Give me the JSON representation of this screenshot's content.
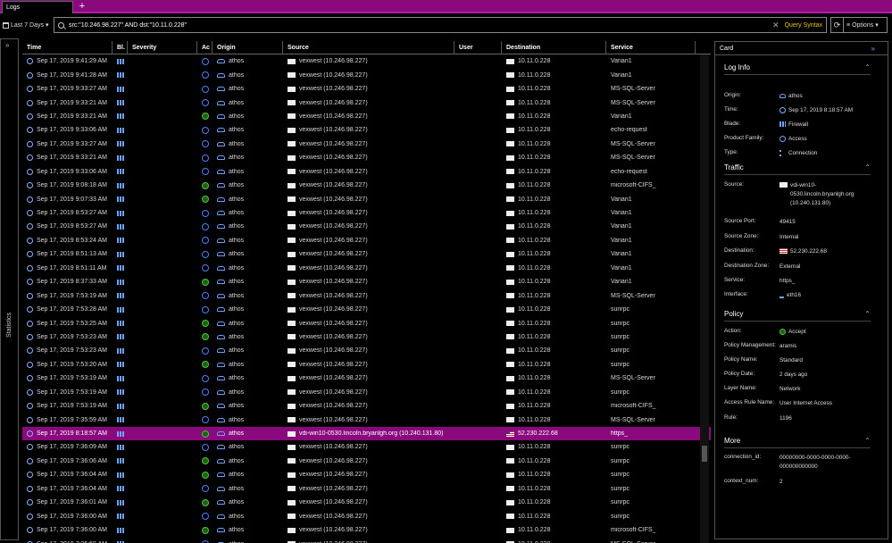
{
  "tabs": {
    "active": "Logs",
    "add": "+"
  },
  "filter": {
    "time_range": "Last 7 Days",
    "query": "src:\"10.246.98.227\" AND dst:\"10.11.0.228\"",
    "clear": "✕",
    "query_syntax": "Query Syntax",
    "refresh": "⟳",
    "options": "Options"
  },
  "statistics": {
    "collapse": "»",
    "label": "Statistics"
  },
  "columns": [
    "Time",
    "Bl.",
    "Severity",
    "Ac",
    "Origin",
    "Source",
    "User",
    "Destination",
    "Service"
  ],
  "rows": [
    {
      "time": "Sep 17, 2019 9:41:29 AM",
      "action": "block",
      "origin": "athos",
      "source": "vexwest (10.246.98.227)",
      "dest": "10.11.0.228",
      "service": "Varian1"
    },
    {
      "time": "Sep 17, 2019 9:41:28 AM",
      "action": "block",
      "origin": "athos",
      "source": "vexwest (10.246.98.227)",
      "dest": "10.11.0.228",
      "service": "Varian1"
    },
    {
      "time": "Sep 17, 2019 9:33:27 AM",
      "action": "block",
      "origin": "athos",
      "source": "vexwest (10.246.98.227)",
      "dest": "10.11.0.228",
      "service": "MS-SQL-Server"
    },
    {
      "time": "Sep 17, 2019 9:33:21 AM",
      "action": "block",
      "origin": "athos",
      "source": "vexwest (10.246.98.227)",
      "dest": "10.11.0.228",
      "service": "MS-SQL-Server"
    },
    {
      "time": "Sep 17, 2019 9:33:21 AM",
      "action": "accept",
      "origin": "athos",
      "source": "vexwest (10.246.98.227)",
      "dest": "10.11.0.228",
      "service": "Varian1"
    },
    {
      "time": "Sep 17, 2019 9:33:06 AM",
      "action": "block",
      "origin": "athos",
      "source": "vexwest (10.246.98.227)",
      "dest": "10.11.0.228",
      "service": "echo-request"
    },
    {
      "time": "Sep 17, 2019 9:33:27 AM",
      "action": "block",
      "origin": "athos",
      "source": "vexwest (10.246.98.227)",
      "dest": "10.11.0.228",
      "service": "MS-SQL-Server"
    },
    {
      "time": "Sep 17, 2019 9:33:21 AM",
      "action": "block",
      "origin": "athos",
      "source": "vexwest (10.246.98.227)",
      "dest": "10.11.0.228",
      "service": "MS-SQL-Server"
    },
    {
      "time": "Sep 17, 2019 9:33:06 AM",
      "action": "block",
      "origin": "athos",
      "source": "vexwest (10.246.98.227)",
      "dest": "10.11.0.228",
      "service": "echo-request"
    },
    {
      "time": "Sep 17, 2019 9:08:18 AM",
      "action": "accept",
      "origin": "athos",
      "source": "vexwest (10.246.98.227)",
      "dest": "10.11.0.228",
      "service": "microsoft-CIFS_"
    },
    {
      "time": "Sep 17, 2019 9:07:33 AM",
      "action": "accept",
      "origin": "athos",
      "source": "vexwest (10.246.98.227)",
      "dest": "10.11.0.228",
      "service": "Varian1"
    },
    {
      "time": "Sep 17, 2019 8:53:27 AM",
      "action": "block",
      "origin": "athos",
      "source": "vexwest (10.246.98.227)",
      "dest": "10.11.0.228",
      "service": "Varian1"
    },
    {
      "time": "Sep 17, 2019 8:53:27 AM",
      "action": "block",
      "origin": "athos",
      "source": "vexwest (10.246.98.227)",
      "dest": "10.11.0.228",
      "service": "Varian1"
    },
    {
      "time": "Sep 17, 2019 8:53:24 AM",
      "action": "block",
      "origin": "athos",
      "source": "vexwest (10.246.98.227)",
      "dest": "10.11.0.228",
      "service": "Varian1"
    },
    {
      "time": "Sep 17, 2019 8:51:13 AM",
      "action": "block",
      "origin": "athos",
      "source": "vexwest (10.246.98.227)",
      "dest": "10.11.0.228",
      "service": "Varian1"
    },
    {
      "time": "Sep 17, 2019 8:51:11 AM",
      "action": "block",
      "origin": "athos",
      "source": "vexwest (10.246.98.227)",
      "dest": "10.11.0.228",
      "service": "Varian1"
    },
    {
      "time": "Sep 17, 2019 8:37:33 AM",
      "action": "accept",
      "origin": "athos",
      "source": "vexwest (10.246.98.227)",
      "dest": "10.11.0.228",
      "service": "Varian1"
    },
    {
      "time": "Sep 17, 2019 7:53:19 AM",
      "action": "block",
      "origin": "athos",
      "source": "vexwest (10.246.98.227)",
      "dest": "10.11.0.228",
      "service": "MS-SQL-Server"
    },
    {
      "time": "Sep 17, 2019 7:53:28 AM",
      "action": "block",
      "origin": "athos",
      "source": "vexwest (10.246.98.227)",
      "dest": "10.11.0.228",
      "service": "sunrpc"
    },
    {
      "time": "Sep 17, 2019 7:53:25 AM",
      "action": "accept",
      "origin": "athos",
      "source": "vexwest (10.246.98.227)",
      "dest": "10.11.0.228",
      "service": "sunrpc"
    },
    {
      "time": "Sep 17, 2019 7:53:23 AM",
      "action": "accept",
      "origin": "athos",
      "source": "vexwest (10.246.98.227)",
      "dest": "10.11.0.228",
      "service": "sunrpc"
    },
    {
      "time": "Sep 17, 2019 7:53:23 AM",
      "action": "block",
      "origin": "athos",
      "source": "vexwest (10.246.98.227)",
      "dest": "10.11.0.228",
      "service": "sunrpc"
    },
    {
      "time": "Sep 17, 2019 7:53:20 AM",
      "action": "accept",
      "origin": "athos",
      "source": "vexwest (10.246.98.227)",
      "dest": "10.11.0.228",
      "service": "sunrpc"
    },
    {
      "time": "Sep 17, 2019 7:53:19 AM",
      "action": "block",
      "origin": "athos",
      "source": "vexwest (10.246.98.227)",
      "dest": "10.11.0.228",
      "service": "MS-SQL-Server"
    },
    {
      "time": "Sep 17, 2019 7:53:19 AM",
      "action": "block",
      "origin": "athos",
      "source": "vexwest (10.246.98.227)",
      "dest": "10.11.0.228",
      "service": "sunrpc"
    },
    {
      "time": "Sep 17, 2019 7:53:19 AM",
      "action": "accept",
      "origin": "athos",
      "source": "vexwest (10.246.98.227)",
      "dest": "10.11.0.228",
      "service": "microsoft-CIFS_"
    },
    {
      "time": "Sep 17, 2019 7:35:59 AM",
      "action": "block",
      "origin": "athos",
      "source": "vexwest (10.246.98.227)",
      "dest": "10.11.0.228",
      "service": "MS-SQL-Server"
    },
    {
      "time": "Sep 17, 2019 8:18:57 AM",
      "action": "accept",
      "origin": "athos",
      "source": "vdi-win10-0530.lincoln.bryanlgh.org (10.240.131.80)",
      "dest": "52.230.222.68",
      "service": "https_",
      "selected": true
    },
    {
      "time": "Sep 17, 2019 7:36:09 AM",
      "action": "block",
      "origin": "athos",
      "source": "vexwest (10.246.98.227)",
      "dest": "10.11.0.228",
      "service": "sunrpc"
    },
    {
      "time": "Sep 17, 2019 7:36:06 AM",
      "action": "accept",
      "origin": "athos",
      "source": "vexwest (10.246.98.227)",
      "dest": "10.11.0.228",
      "service": "sunrpc"
    },
    {
      "time": "Sep 17, 2019 7:36:04 AM",
      "action": "accept",
      "origin": "athos",
      "source": "vexwest (10.246.98.227)",
      "dest": "10.11.0.228",
      "service": "sunrpc"
    },
    {
      "time": "Sep 17, 2019 7:36:04 AM",
      "action": "block",
      "origin": "athos",
      "source": "vexwest (10.246.98.227)",
      "dest": "10.11.0.228",
      "service": "sunrpc"
    },
    {
      "time": "Sep 17, 2019 7:36:01 AM",
      "action": "accept",
      "origin": "athos",
      "source": "vexwest (10.246.98.227)",
      "dest": "10.11.0.228",
      "service": "sunrpc"
    },
    {
      "time": "Sep 17, 2019 7:36:00 AM",
      "action": "block",
      "origin": "athos",
      "source": "vexwest (10.246.98.227)",
      "dest": "10.11.0.228",
      "service": "sunrpc"
    },
    {
      "time": "Sep 17, 2019 7:36:00 AM",
      "action": "accept",
      "origin": "athos",
      "source": "vexwest (10.246.98.227)",
      "dest": "10.11.0.228",
      "service": "microsoft-CIFS_"
    },
    {
      "time": "Sep 17, 2019 7:35:59 AM",
      "action": "block",
      "origin": "athos",
      "source": "vexwest (10.246.98.227)",
      "dest": "10.11.0.228",
      "service": "MS-SQL-Server"
    }
  ],
  "card": {
    "title": "Card",
    "collapse": "»",
    "sections": {
      "log_info": "Log Info",
      "traffic": "Traffic",
      "policy": "Policy",
      "more": "More"
    },
    "log_info": [
      {
        "k": "Origin:",
        "v": "athos",
        "icon": "origin"
      },
      {
        "k": "Time:",
        "v": "Sep 17, 2019 8:18:57 AM",
        "icon": "clock"
      },
      {
        "k": "Blade:",
        "v": "Firewall",
        "icon": "blade"
      },
      {
        "k": "Product Family:",
        "v": "Access",
        "icon": "family"
      },
      {
        "k": "Type:",
        "v": "Connection",
        "icon": "type"
      }
    ],
    "traffic": [
      {
        "k": "Source:",
        "v": "vdi-win10-0530.lincoln.bryanlgh.org (10.240.131.80)",
        "icon": "host"
      },
      {
        "k": "Source Port:",
        "v": "49415",
        "icon": ""
      },
      {
        "k": "Source Zone:",
        "v": "Internal",
        "icon": ""
      },
      {
        "k": "Destination:",
        "v": "52.230.222.68",
        "icon": "flag"
      },
      {
        "k": "Destination Zone:",
        "v": "External",
        "icon": ""
      },
      {
        "k": "Service:",
        "v": "https_",
        "icon": ""
      },
      {
        "k": "Interface:",
        "v": "eth16",
        "icon": "iface"
      }
    ],
    "policy": [
      {
        "k": "Action:",
        "v": "Accept",
        "icon": "accept"
      },
      {
        "k": "Policy Management:",
        "v": "aramis",
        "icon": ""
      },
      {
        "k": "Policy Name:",
        "v": "Standard",
        "icon": ""
      },
      {
        "k": "Policy Date:",
        "v": "2 days ago",
        "icon": ""
      },
      {
        "k": "Layer Name:",
        "v": "Network",
        "icon": ""
      },
      {
        "k": "Access Rule Name:",
        "v": "User Internet Access",
        "icon": ""
      },
      {
        "k": "Rule:",
        "v": "1196",
        "icon": ""
      }
    ],
    "more": [
      {
        "k": "connection_id:",
        "v": "00000000-0000-0000-0000-000000000000",
        "icon": ""
      },
      {
        "k": "context_num:",
        "v": "2",
        "icon": ""
      }
    ]
  },
  "colors": {
    "accent": "#8a0a7e",
    "query_syntax": "#e8c400",
    "accept": "#4fc33a",
    "icon_blue": "#6fa3ff"
  }
}
